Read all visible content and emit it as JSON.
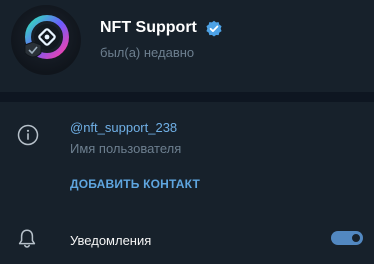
{
  "profile": {
    "name": "NFT Support",
    "status": "был(а) недавно",
    "avatar_icon": "nft-logo-icon",
    "verified_icon": "verified-badge-icon"
  },
  "info": {
    "username": "@nft_support_238",
    "username_label": "Имя пользователя",
    "add_contact": "ДОБАВИТЬ КОНТАКТ"
  },
  "notifications": {
    "label": "Уведомления",
    "enabled": true
  },
  "colors": {
    "background": "#17212b",
    "divider": "#0e1621",
    "accent": "#5288c1",
    "link": "#70b0e6",
    "secondary_text": "#6d7f8f"
  }
}
